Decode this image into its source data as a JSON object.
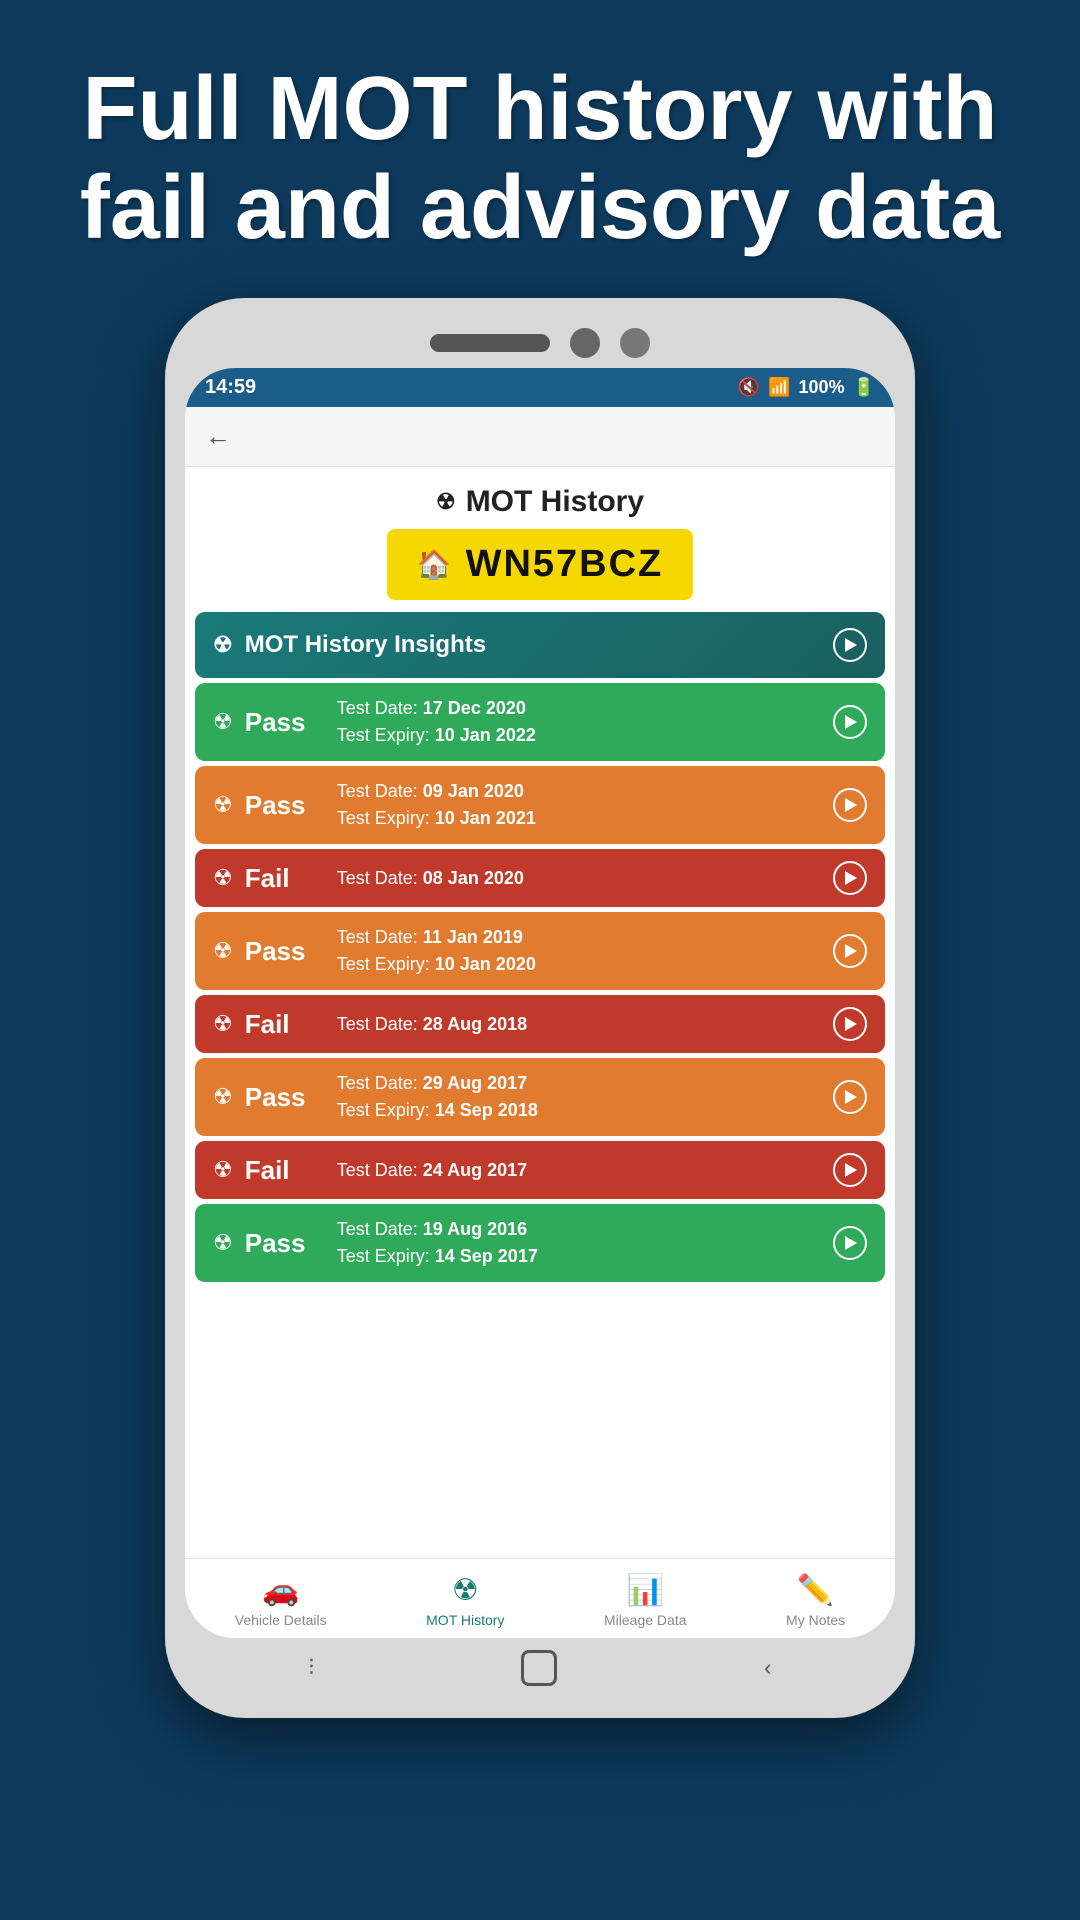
{
  "page": {
    "header": "Full MOT history with fail and advisory data"
  },
  "status_bar": {
    "time": "14:59",
    "signal_icon": "📶",
    "battery": "100%"
  },
  "app": {
    "title": "MOT History",
    "plate": "WN57BCZ"
  },
  "insights": {
    "label": "MOT History Insights"
  },
  "mot_entries": [
    {
      "result": "Pass",
      "color": "pass-green",
      "test_date_label": "Test Date:",
      "test_date": "17 Dec 2020",
      "expiry_label": "Test Expiry:",
      "expiry": "10 Jan 2022",
      "has_expiry": true
    },
    {
      "result": "Pass",
      "color": "pass-orange",
      "test_date_label": "Test Date:",
      "test_date": "09 Jan 2020",
      "expiry_label": "Test Expiry:",
      "expiry": "10 Jan 2021",
      "has_expiry": true
    },
    {
      "result": "Fail",
      "color": "fail-red",
      "test_date_label": "Test Date:",
      "test_date": "08 Jan 2020",
      "expiry_label": null,
      "expiry": null,
      "has_expiry": false
    },
    {
      "result": "Pass",
      "color": "pass-orange",
      "test_date_label": "Test Date:",
      "test_date": "11 Jan 2019",
      "expiry_label": "Test Expiry:",
      "expiry": "10 Jan 2020",
      "has_expiry": true
    },
    {
      "result": "Fail",
      "color": "fail-red",
      "test_date_label": "Test Date:",
      "test_date": "28 Aug 2018",
      "expiry_label": null,
      "expiry": null,
      "has_expiry": false
    },
    {
      "result": "Pass",
      "color": "pass-orange",
      "test_date_label": "Test Date:",
      "test_date": "29 Aug 2017",
      "expiry_label": "Test Expiry:",
      "expiry": "14 Sep 2018",
      "has_expiry": true
    },
    {
      "result": "Fail",
      "color": "fail-red",
      "test_date_label": "Test Date:",
      "test_date": "24 Aug 2017",
      "expiry_label": null,
      "expiry": null,
      "has_expiry": false
    },
    {
      "result": "Pass",
      "color": "pass-green",
      "test_date_label": "Test Date:",
      "test_date": "19 Aug 2016",
      "expiry_label": "Test Expiry:",
      "expiry": "14 Sep 2017",
      "has_expiry": true
    }
  ],
  "bottom_nav": [
    {
      "label": "Vehicle Details",
      "icon": "🚗",
      "active": false
    },
    {
      "label": "MOT History",
      "icon": "☢",
      "active": true
    },
    {
      "label": "Mileage Data",
      "icon": "📊",
      "active": false
    },
    {
      "label": "My Notes",
      "icon": "✏️",
      "active": false
    }
  ]
}
